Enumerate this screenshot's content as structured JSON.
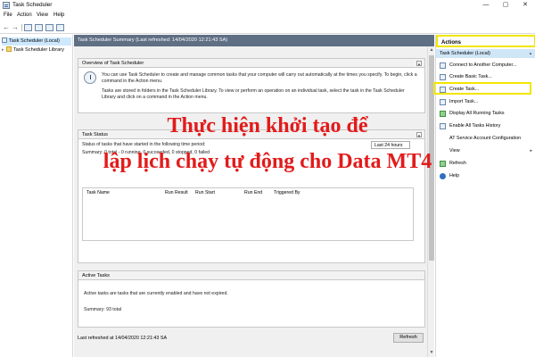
{
  "window": {
    "title": "Task Scheduler",
    "min_glyph": "—",
    "max_glyph": "▢",
    "close_glyph": "✕"
  },
  "menu": [
    "File",
    "Action",
    "View",
    "Help"
  ],
  "toolbar": {
    "back_glyph": "←",
    "forward_glyph": "→"
  },
  "tree": {
    "items": [
      {
        "label": "Task Scheduler (Local)",
        "selected": true
      },
      {
        "label": "Task Scheduler Library",
        "selected": false
      }
    ]
  },
  "center": {
    "header": "Task Scheduler Summary (Last refreshed: 14/04/2020 12:21:43 SA)",
    "overview": {
      "title": "Overview of Task Scheduler",
      "p1": "You can use Task Scheduler to create and manage common tasks that your computer will carry out automatically at the times you specify. To begin, click a command in the Action menu.",
      "p2": "Tasks are stored in folders in the Task Scheduler Library. To view or perform an operation on an individual task, select the task in the Task Scheduler Library and click on a command in the Action menu."
    },
    "task_status": {
      "title": "Task Status",
      "status_text": "Status of tasks that have started in the following time period:",
      "summary": "Summary: 0 total - 0 running, 0 succeeded, 0 stopped, 0 failed",
      "period": "Last 24 hours",
      "columns": [
        "Task Name",
        "Run Result",
        "Run Start",
        "Run End",
        "Triggered By"
      ]
    },
    "active_tasks": {
      "title": "Active Tasks",
      "desc": "Active tasks are tasks that are currently enabled and have not expired.",
      "summary": "Summary: 93 total"
    },
    "last_refreshed": "Last refreshed at 14/04/2020 12:21:43 SA",
    "refresh_label": "Refresh"
  },
  "actions": {
    "title": "Actions",
    "group": "Task Scheduler (Local)",
    "items": [
      {
        "label": "Connect to Another Computer...",
        "icon": "computer-icon"
      },
      {
        "label": "Create Basic Task...",
        "icon": "basic-task-icon"
      },
      {
        "label": "Create Task...",
        "icon": "create-task-icon"
      },
      {
        "label": "Import Task...",
        "icon": "import-icon"
      },
      {
        "label": "Display All Running Tasks",
        "icon": "run-icon"
      },
      {
        "label": "Enable All Tasks History",
        "icon": "history-icon"
      },
      {
        "label": "AT Service Account Configuration",
        "icon": "config-icon"
      },
      {
        "label": "View",
        "icon": "view-icon",
        "submenu": true
      },
      {
        "label": "Refresh",
        "icon": "refresh-icon"
      },
      {
        "label": "Help",
        "icon": "help-icon"
      }
    ]
  },
  "overlay": {
    "line1": "Thực hiện khởi tạo để",
    "line2": "lập lịch chạy tự động cho Data MT4",
    "color": "#e21b1b"
  },
  "highlight_color": "#f2e500"
}
